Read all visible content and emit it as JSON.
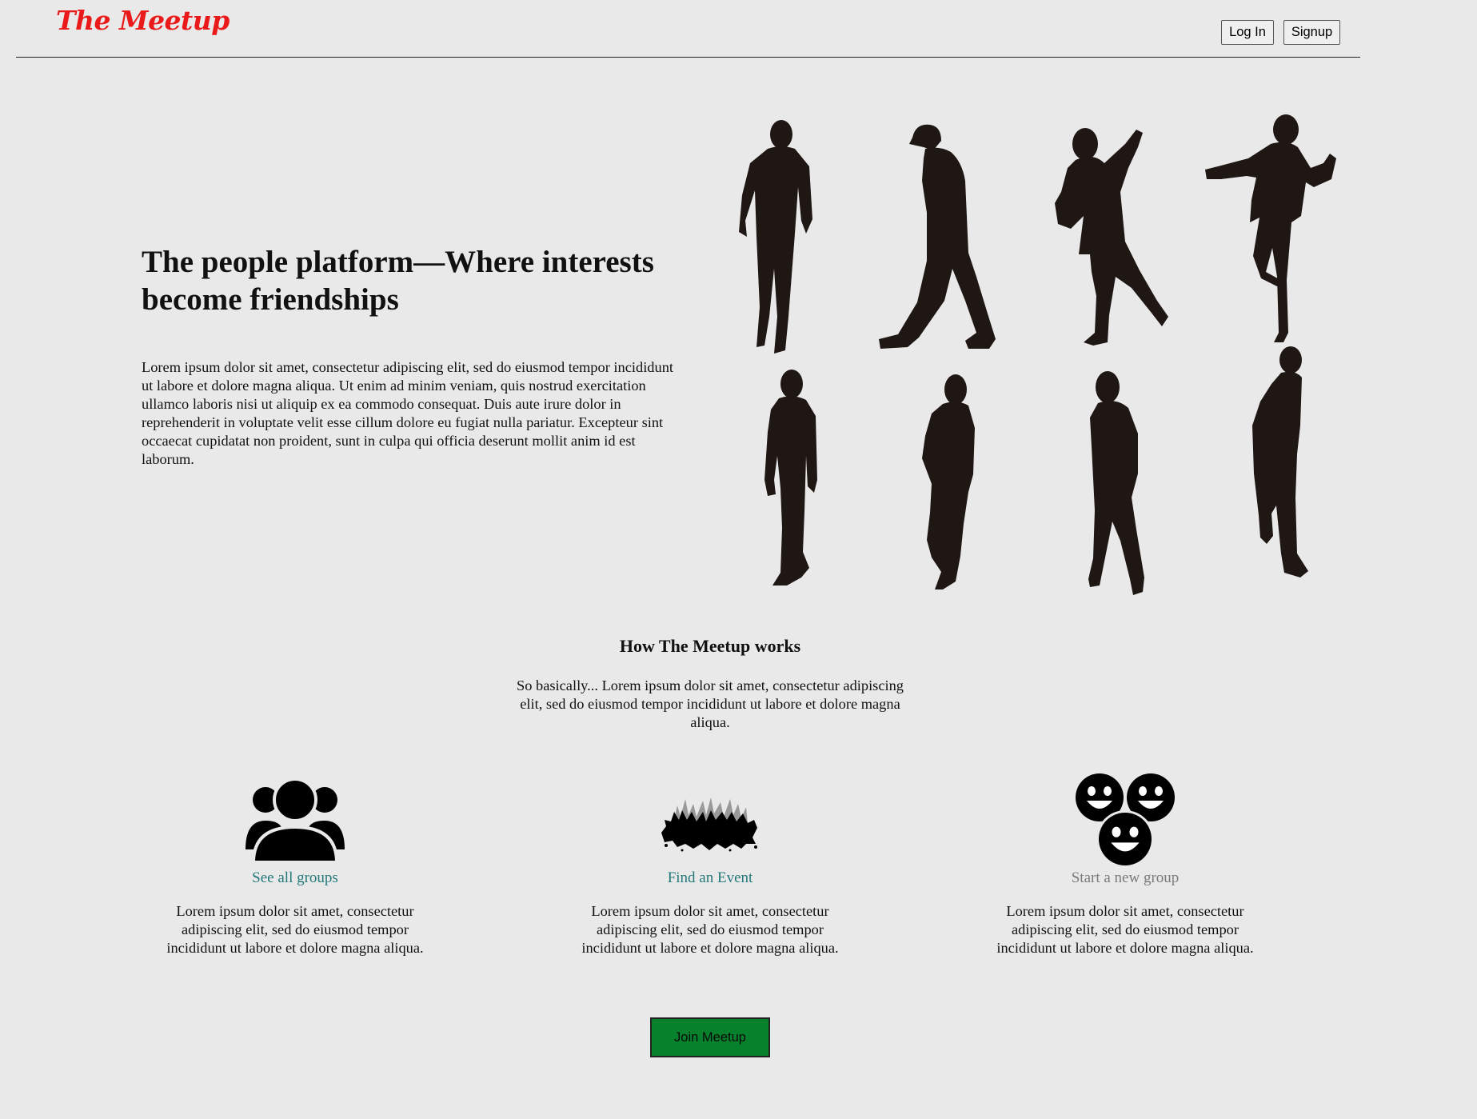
{
  "header": {
    "logo_text": "The Meetup",
    "login_label": "Log In",
    "signup_label": "Signup"
  },
  "hero": {
    "title": "The people platform—Where interests become friendships",
    "body": "Lorem ipsum dolor sit amet, consectetur adipiscing elit, sed do eiusmod tempor incididunt ut labore et dolore magna aliqua. Ut enim ad minim veniam, quis nostrud exercitation ullamco laboris nisi ut aliquip ex ea commodo consequat. Duis aute irure dolor in reprehenderit in voluptate velit esse cillum dolore eu fugiat nulla pariatur. Excepteur sint occaecat cupidatat non proident, sunt in culpa qui officia deserunt mollit anim id est laborum."
  },
  "how": {
    "title": "How The Meetup works",
    "text": "So basically... Lorem ipsum dolor sit amet, consectetur adipiscing elit, sed do eiusmod tempor incididunt ut labore et dolore magna aliqua."
  },
  "features": [
    {
      "icon": "group-icon",
      "label": "See all groups",
      "text": "Lorem ipsum dolor sit amet, consectetur adipiscing elit, sed do eiusmod tempor incididunt ut labore et dolore magna aliqua."
    },
    {
      "icon": "crowd-icon",
      "label": "Find an Event",
      "text": "Lorem ipsum dolor sit amet, consectetur adipiscing elit, sed do eiusmod tempor incididunt ut labore et dolore magna aliqua."
    },
    {
      "icon": "smiley-faces-icon",
      "label": "Start a new group",
      "text": "Lorem ipsum dolor sit amet, consectetur adipiscing elit, sed do eiusmod tempor incididunt ut labore et dolore magna aliqua."
    }
  ],
  "join_label": "Join Meetup",
  "colors": {
    "logo": "#ea1a1a",
    "link": "#23797a",
    "link_muted": "#7a7a7a",
    "join_button": "#08812c",
    "background": "#eae9e9"
  }
}
